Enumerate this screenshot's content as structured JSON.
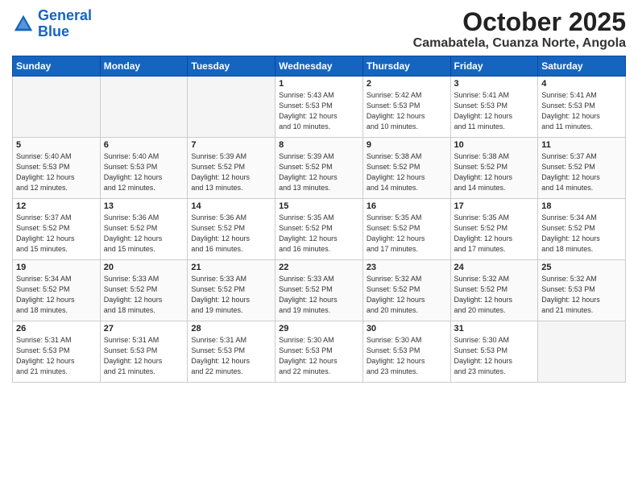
{
  "header": {
    "logo_line1": "General",
    "logo_line2": "Blue",
    "month": "October 2025",
    "location": "Camabatela, Cuanza Norte, Angola"
  },
  "weekdays": [
    "Sunday",
    "Monday",
    "Tuesday",
    "Wednesday",
    "Thursday",
    "Friday",
    "Saturday"
  ],
  "weeks": [
    [
      {
        "day": "",
        "info": ""
      },
      {
        "day": "",
        "info": ""
      },
      {
        "day": "",
        "info": ""
      },
      {
        "day": "1",
        "info": "Sunrise: 5:43 AM\nSunset: 5:53 PM\nDaylight: 12 hours\nand 10 minutes."
      },
      {
        "day": "2",
        "info": "Sunrise: 5:42 AM\nSunset: 5:53 PM\nDaylight: 12 hours\nand 10 minutes."
      },
      {
        "day": "3",
        "info": "Sunrise: 5:41 AM\nSunset: 5:53 PM\nDaylight: 12 hours\nand 11 minutes."
      },
      {
        "day": "4",
        "info": "Sunrise: 5:41 AM\nSunset: 5:53 PM\nDaylight: 12 hours\nand 11 minutes."
      }
    ],
    [
      {
        "day": "5",
        "info": "Sunrise: 5:40 AM\nSunset: 5:53 PM\nDaylight: 12 hours\nand 12 minutes."
      },
      {
        "day": "6",
        "info": "Sunrise: 5:40 AM\nSunset: 5:53 PM\nDaylight: 12 hours\nand 12 minutes."
      },
      {
        "day": "7",
        "info": "Sunrise: 5:39 AM\nSunset: 5:52 PM\nDaylight: 12 hours\nand 13 minutes."
      },
      {
        "day": "8",
        "info": "Sunrise: 5:39 AM\nSunset: 5:52 PM\nDaylight: 12 hours\nand 13 minutes."
      },
      {
        "day": "9",
        "info": "Sunrise: 5:38 AM\nSunset: 5:52 PM\nDaylight: 12 hours\nand 14 minutes."
      },
      {
        "day": "10",
        "info": "Sunrise: 5:38 AM\nSunset: 5:52 PM\nDaylight: 12 hours\nand 14 minutes."
      },
      {
        "day": "11",
        "info": "Sunrise: 5:37 AM\nSunset: 5:52 PM\nDaylight: 12 hours\nand 14 minutes."
      }
    ],
    [
      {
        "day": "12",
        "info": "Sunrise: 5:37 AM\nSunset: 5:52 PM\nDaylight: 12 hours\nand 15 minutes."
      },
      {
        "day": "13",
        "info": "Sunrise: 5:36 AM\nSunset: 5:52 PM\nDaylight: 12 hours\nand 15 minutes."
      },
      {
        "day": "14",
        "info": "Sunrise: 5:36 AM\nSunset: 5:52 PM\nDaylight: 12 hours\nand 16 minutes."
      },
      {
        "day": "15",
        "info": "Sunrise: 5:35 AM\nSunset: 5:52 PM\nDaylight: 12 hours\nand 16 minutes."
      },
      {
        "day": "16",
        "info": "Sunrise: 5:35 AM\nSunset: 5:52 PM\nDaylight: 12 hours\nand 17 minutes."
      },
      {
        "day": "17",
        "info": "Sunrise: 5:35 AM\nSunset: 5:52 PM\nDaylight: 12 hours\nand 17 minutes."
      },
      {
        "day": "18",
        "info": "Sunrise: 5:34 AM\nSunset: 5:52 PM\nDaylight: 12 hours\nand 18 minutes."
      }
    ],
    [
      {
        "day": "19",
        "info": "Sunrise: 5:34 AM\nSunset: 5:52 PM\nDaylight: 12 hours\nand 18 minutes."
      },
      {
        "day": "20",
        "info": "Sunrise: 5:33 AM\nSunset: 5:52 PM\nDaylight: 12 hours\nand 18 minutes."
      },
      {
        "day": "21",
        "info": "Sunrise: 5:33 AM\nSunset: 5:52 PM\nDaylight: 12 hours\nand 19 minutes."
      },
      {
        "day": "22",
        "info": "Sunrise: 5:33 AM\nSunset: 5:52 PM\nDaylight: 12 hours\nand 19 minutes."
      },
      {
        "day": "23",
        "info": "Sunrise: 5:32 AM\nSunset: 5:52 PM\nDaylight: 12 hours\nand 20 minutes."
      },
      {
        "day": "24",
        "info": "Sunrise: 5:32 AM\nSunset: 5:52 PM\nDaylight: 12 hours\nand 20 minutes."
      },
      {
        "day": "25",
        "info": "Sunrise: 5:32 AM\nSunset: 5:53 PM\nDaylight: 12 hours\nand 21 minutes."
      }
    ],
    [
      {
        "day": "26",
        "info": "Sunrise: 5:31 AM\nSunset: 5:53 PM\nDaylight: 12 hours\nand 21 minutes."
      },
      {
        "day": "27",
        "info": "Sunrise: 5:31 AM\nSunset: 5:53 PM\nDaylight: 12 hours\nand 21 minutes."
      },
      {
        "day": "28",
        "info": "Sunrise: 5:31 AM\nSunset: 5:53 PM\nDaylight: 12 hours\nand 22 minutes."
      },
      {
        "day": "29",
        "info": "Sunrise: 5:30 AM\nSunset: 5:53 PM\nDaylight: 12 hours\nand 22 minutes."
      },
      {
        "day": "30",
        "info": "Sunrise: 5:30 AM\nSunset: 5:53 PM\nDaylight: 12 hours\nand 23 minutes."
      },
      {
        "day": "31",
        "info": "Sunrise: 5:30 AM\nSunset: 5:53 PM\nDaylight: 12 hours\nand 23 minutes."
      },
      {
        "day": "",
        "info": ""
      }
    ]
  ]
}
